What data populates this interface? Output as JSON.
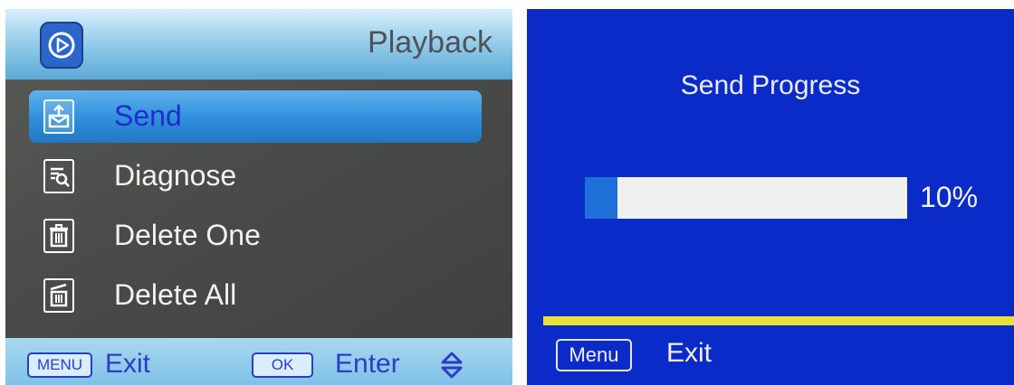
{
  "playback_screen": {
    "header": {
      "title": "Playback",
      "icon": "play-circle-icon",
      "accent": "#2b66c9"
    },
    "menu": [
      {
        "label": "Send",
        "icon": "send-envelope-icon",
        "selected": true
      },
      {
        "label": "Diagnose",
        "icon": "diagnose-magnifier-icon",
        "selected": false
      },
      {
        "label": "Delete One",
        "icon": "trash-icon",
        "selected": false
      },
      {
        "label": "Delete All",
        "icon": "trash-all-icon",
        "selected": false
      }
    ],
    "footer": {
      "menu_key": "MENU",
      "exit_label": "Exit",
      "ok_key": "OK",
      "enter_label": "Enter",
      "updown_icon": "up-down-arrows-icon"
    },
    "colors": {
      "selected_bg": "#2f8fdb",
      "selected_text": "#1f2ccf",
      "footer_text": "#2b3dc8"
    }
  },
  "send_progress_screen": {
    "title": "Send Progress",
    "progress": 0.1,
    "percent_label": "10%",
    "footer": {
      "menu_key": "Menu",
      "exit_label": "Exit"
    },
    "colors": {
      "background": "#0b2bc8",
      "fill": "#1f6fd8",
      "divider": "#e6e233"
    }
  }
}
